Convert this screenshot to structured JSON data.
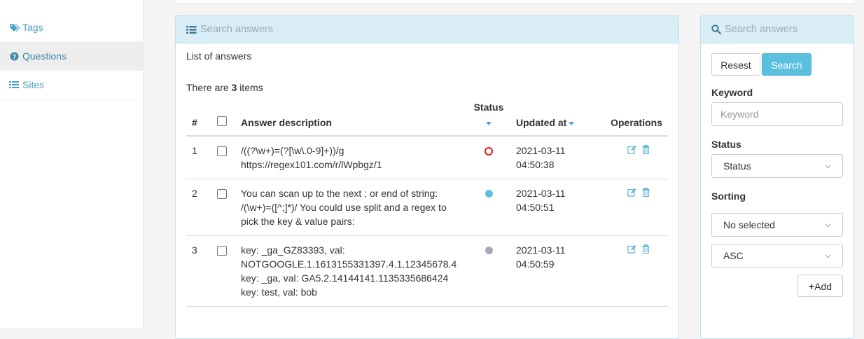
{
  "sidebar": {
    "items": [
      {
        "label": "Tags",
        "icon": "tags-icon",
        "active": false
      },
      {
        "label": "Questions",
        "icon": "question-circle-icon",
        "active": true
      },
      {
        "label": "Sites",
        "icon": "list-icon",
        "active": false
      }
    ]
  },
  "main": {
    "header": "Search answers",
    "list_title": "List of answers",
    "count_prefix": "There are ",
    "count": "3",
    "count_suffix": " items",
    "columns": {
      "num": "#",
      "description": "Answer description",
      "status": "Status",
      "updated": "Updated at",
      "operations": "Operations"
    },
    "rows": [
      {
        "num": "1",
        "lines": [
          "/((?\\w+)=(?[\\w\\.0-9]+))/g",
          "https://regex101.com/r/lWpbgz/1"
        ],
        "status": "inactive",
        "date": "2021-03-11",
        "time": "04:50:38"
      },
      {
        "num": "2",
        "lines": [
          "You can scan up to the next ; or end of string:",
          "/(\\w+)=([^;]*)/ You could use split and a regex to",
          "pick the key & value pairs:"
        ],
        "status": "active",
        "date": "2021-03-11",
        "time": "04:50:51"
      },
      {
        "num": "3",
        "lines": [
          "key: _ga_GZ83393, val:",
          "NOTGOOGLE.1.1613155331397.4.1.12345678.4",
          "key: _ga, val: GA5.2.14144141.1135335686424",
          "key: test, val: bob"
        ],
        "status": "pending",
        "date": "2021-03-11",
        "time": "04:50:59"
      }
    ]
  },
  "search_panel": {
    "header": "Search answers",
    "reset_label": "Resest",
    "search_label": "Search",
    "keyword_label": "Keyword",
    "keyword_placeholder": "Keyword",
    "status_label": "Status",
    "status_value": "Status",
    "sorting_label": "Sorting",
    "sorting_value": "No selected",
    "order_value": "ASC",
    "add_label": "Add"
  },
  "colors": {
    "accent": "#5bc0de",
    "status_inactive": "#e02020",
    "status_active": "#5bc0de",
    "status_pending": "#a3a8bd"
  }
}
